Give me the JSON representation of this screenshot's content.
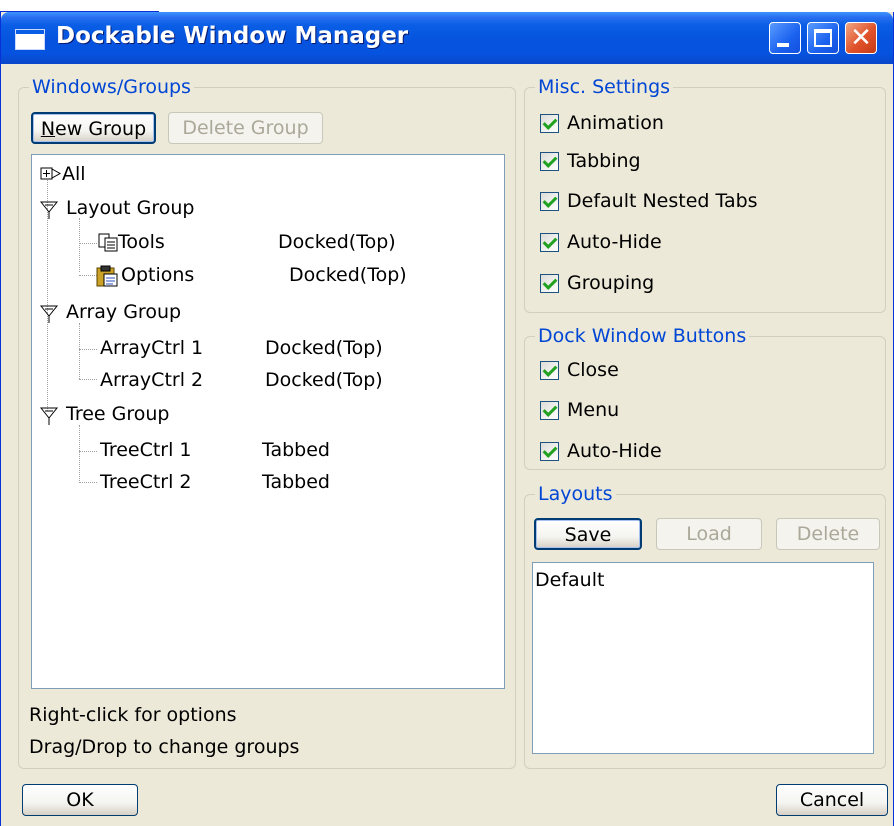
{
  "window": {
    "title": "Dockable Window Manager"
  },
  "colors": {
    "titlebar": "#0553de",
    "legend": "#0046d5",
    "check": "#21a121"
  },
  "windows_groups": {
    "legend": "Windows/Groups",
    "new_group_label": "New Group",
    "delete_group_label": "Delete Group",
    "tree": [
      {
        "label": "All",
        "icon": "expand-icon"
      },
      {
        "label": "Layout Group",
        "icon": "collapse-icon",
        "children": [
          {
            "label": "Tools",
            "status": "Docked(Top)",
            "icon": "tools-icon"
          },
          {
            "label": "Options",
            "status": "Docked(Top)",
            "icon": "options-icon"
          }
        ]
      },
      {
        "label": "Array Group",
        "icon": "collapse-icon",
        "children": [
          {
            "label": "ArrayCtrl 1",
            "status": "Docked(Top)"
          },
          {
            "label": "ArrayCtrl 2",
            "status": "Docked(Top)"
          }
        ]
      },
      {
        "label": "Tree Group",
        "icon": "collapse-icon",
        "children": [
          {
            "label": "TreeCtrl 1",
            "status": "Tabbed"
          },
          {
            "label": "TreeCtrl 2",
            "status": "Tabbed"
          }
        ]
      }
    ],
    "hint1": "Right-click for options",
    "hint2": "Drag/Drop to change groups"
  },
  "misc": {
    "legend": "Misc. Settings",
    "items": [
      {
        "label": "Animation",
        "checked": true
      },
      {
        "label": "Tabbing",
        "checked": true
      },
      {
        "label": "Default Nested Tabs",
        "checked": true
      },
      {
        "label": "Auto-Hide",
        "checked": true
      },
      {
        "label": "Grouping",
        "checked": true
      }
    ]
  },
  "dock_buttons": {
    "legend": "Dock Window Buttons",
    "items": [
      {
        "label": "Close",
        "checked": true
      },
      {
        "label": "Menu",
        "checked": true
      },
      {
        "label": "Auto-Hide",
        "checked": true
      }
    ]
  },
  "layouts": {
    "legend": "Layouts",
    "save_label": "Save",
    "load_label": "Load",
    "delete_label": "Delete",
    "items": [
      "Default"
    ]
  },
  "footer": {
    "ok_label": "OK",
    "cancel_label": "Cancel"
  }
}
